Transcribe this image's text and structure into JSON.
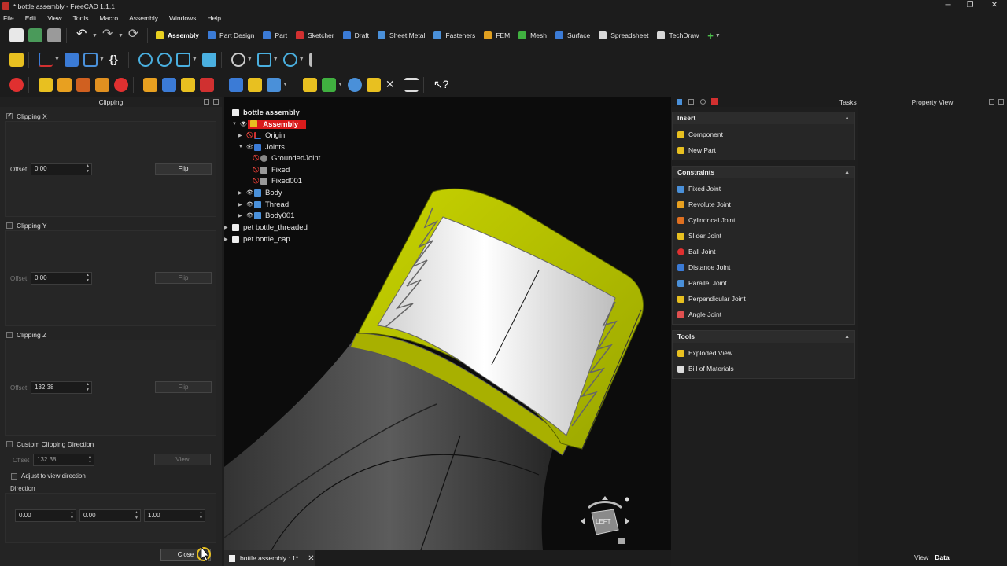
{
  "window": {
    "title": "* bottle assembly - FreeCAD 1.1.1",
    "minimize": "─",
    "maximize": "❐",
    "close": "✕"
  },
  "menu": [
    "File",
    "Edit",
    "View",
    "Tools",
    "Macro",
    "Assembly",
    "Windows",
    "Help"
  ],
  "workbenches": [
    {
      "label": "Assembly",
      "color": "#e8d020"
    },
    {
      "label": "Part Design",
      "color": "#3b7bd6"
    },
    {
      "label": "Part",
      "color": "#3b7bd6"
    },
    {
      "label": "Sketcher",
      "color": "#d23030"
    },
    {
      "label": "Draft",
      "color": "#3b7bd6"
    },
    {
      "label": "Sheet Metal",
      "color": "#4a90d9"
    },
    {
      "label": "Fasteners",
      "color": "#4a90d9"
    },
    {
      "label": "FEM",
      "color": "#e0a020"
    },
    {
      "label": "Mesh",
      "color": "#40b040"
    },
    {
      "label": "Surface",
      "color": "#3b7bd6"
    },
    {
      "label": "Spreadsheet",
      "color": "#d8d8d8"
    },
    {
      "label": "TechDraw",
      "color": "#d8d8d8"
    }
  ],
  "clipping_panel": {
    "title": "Clipping",
    "x": {
      "label": "Clipping X",
      "checked": true,
      "offset_label": "Offset",
      "offset": "0.00",
      "flip": "Flip"
    },
    "y": {
      "label": "Clipping Y",
      "checked": false,
      "offset_label": "Offset",
      "offset": "0.00",
      "flip": "Flip"
    },
    "z": {
      "label": "Clipping Z",
      "checked": false,
      "offset_label": "Offset",
      "offset": "132.38",
      "flip": "Flip"
    },
    "custom": {
      "label": "Custom Clipping Direction",
      "offset_label": "Offset",
      "offset": "132.38",
      "view": "View",
      "adjust_label": "Adjust to view direction",
      "direction_label": "Direction",
      "dx": "0.00",
      "dy": "0.00",
      "dz": "1.00"
    },
    "close": "Close"
  },
  "tree": {
    "root": "bottle assembly",
    "assembly": "Assembly",
    "origin": "Origin",
    "joints": "Joints",
    "grounded": "GroundedJoint",
    "fixed": "Fixed",
    "fixed001": "Fixed001",
    "body": "Body",
    "thread": "Thread",
    "body001": "Body001",
    "pet_threaded": "pet bottle_threaded",
    "pet_cap": "pet bottle_cap"
  },
  "tasks": {
    "tab_label": "Tasks",
    "insert": {
      "title": "Insert",
      "items": [
        "Component",
        "New Part"
      ]
    },
    "constraints": {
      "title": "Constraints",
      "items": [
        "Fixed Joint",
        "Revolute Joint",
        "Cylindrical Joint",
        "Slider Joint",
        "Ball Joint",
        "Distance Joint",
        "Parallel Joint",
        "Perpendicular Joint",
        "Angle Joint"
      ]
    },
    "tools": {
      "title": "Tools",
      "items": [
        "Exploded View",
        "Bill of Materials"
      ]
    }
  },
  "property_view": {
    "title": "Property View",
    "tab_view": "View",
    "tab_data": "Data"
  },
  "document_tab": {
    "label": "bottle assembly : 1*"
  },
  "navcube": {
    "face": "LEFT"
  }
}
